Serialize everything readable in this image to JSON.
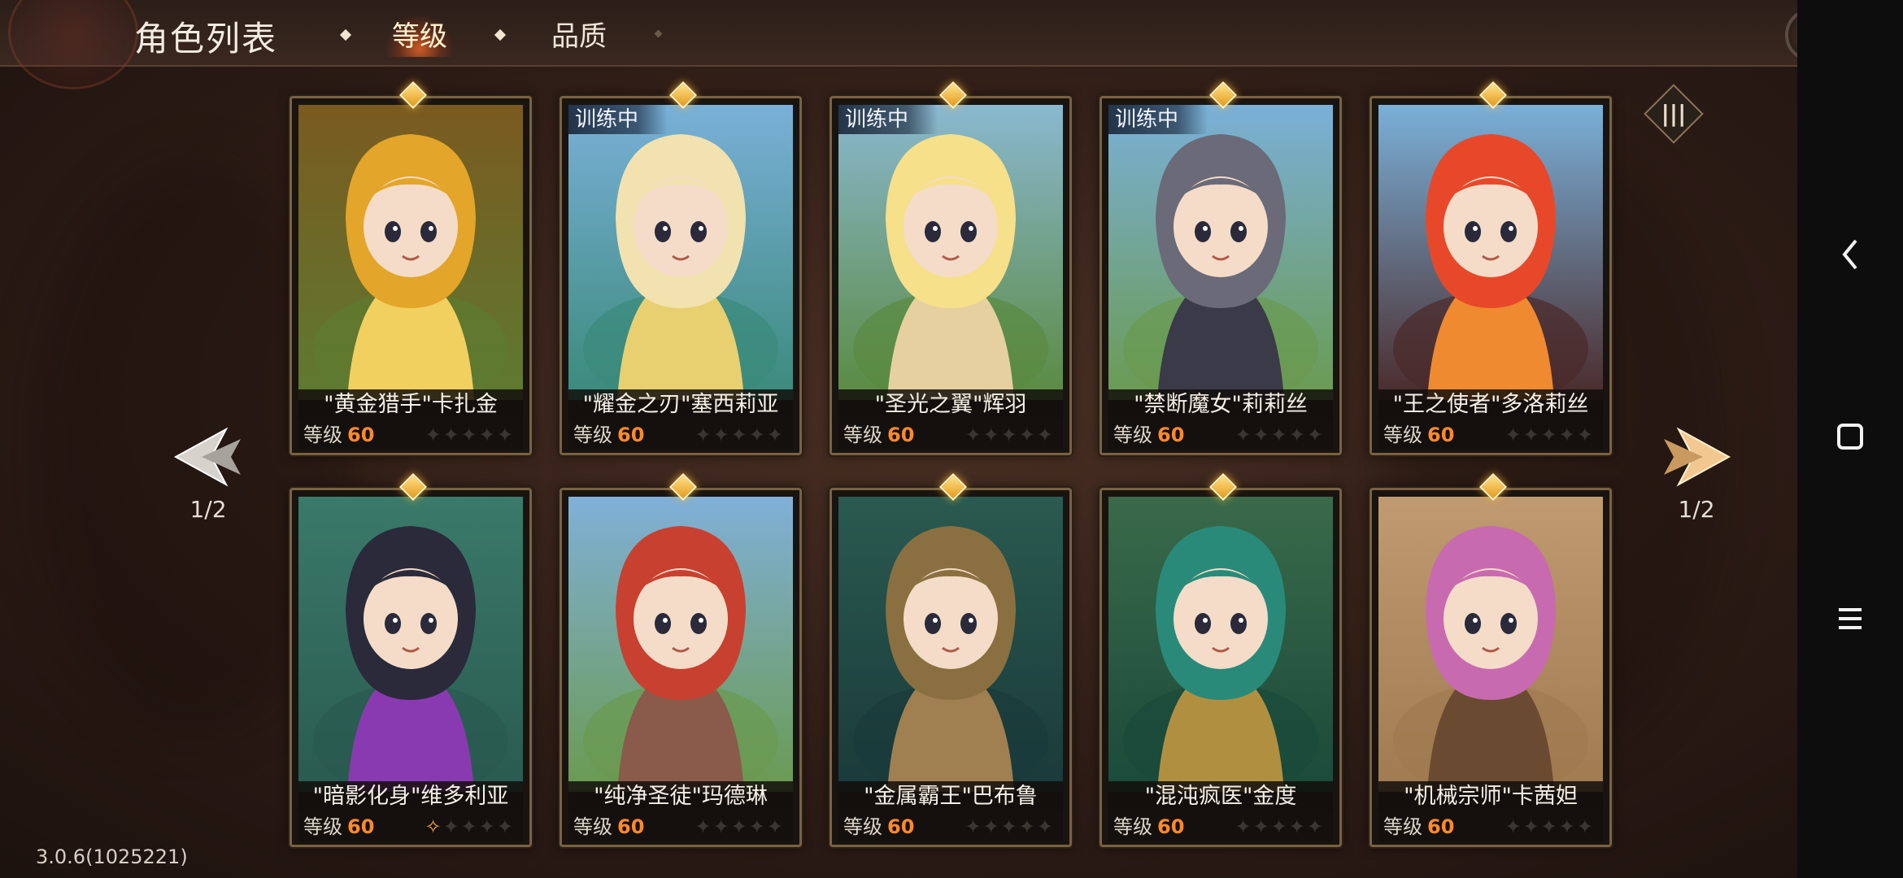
{
  "header": {
    "title": "角色列表",
    "tabs": [
      {
        "label": "等级",
        "active": true
      },
      {
        "label": "品质",
        "active": false
      }
    ]
  },
  "nav": {
    "left_page": "1/2",
    "right_page": "1/2"
  },
  "version": "3.0.6(1025221)",
  "level_label": "等级",
  "training_label": "训练中",
  "characters": [
    {
      "name": "\"黄金猎手\"卡扎金",
      "level": "60",
      "training": false,
      "stars_lit": 0,
      "palette": [
        "#e3a52a",
        "#7a5a20",
        "#f2d060",
        "#5e7a30"
      ]
    },
    {
      "name": "\"耀金之刃\"塞西莉亚",
      "level": "60",
      "training": true,
      "stars_lit": 0,
      "palette": [
        "#f2e2b0",
        "#7ab0d8",
        "#e8d070",
        "#3a8a7a"
      ]
    },
    {
      "name": "\"圣光之翼\"辉羽",
      "level": "60",
      "training": true,
      "stars_lit": 0,
      "palette": [
        "#f6e08a",
        "#8ab8d0",
        "#e6d0a0",
        "#5a8a40"
      ]
    },
    {
      "name": "\"禁断魔女\"莉莉丝",
      "level": "60",
      "training": true,
      "stars_lit": 0,
      "palette": [
        "#6a6a78",
        "#7ab0d8",
        "#3a3a48",
        "#6a9a50"
      ]
    },
    {
      "name": "\"王之使者\"多洛莉丝",
      "level": "60",
      "training": false,
      "stars_lit": 0,
      "palette": [
        "#e8482a",
        "#7ab0d8",
        "#f08a30",
        "#4a2a2a"
      ]
    },
    {
      "name": "\"暗影化身\"维多利亚",
      "level": "60",
      "training": false,
      "stars_lit": 1,
      "palette": [
        "#2a2a3a",
        "#3a7a6a",
        "#8a3ab0",
        "#2a5a50"
      ]
    },
    {
      "name": "\"纯净圣徒\"玛德琳",
      "level": "60",
      "training": false,
      "stars_lit": 0,
      "palette": [
        "#c84030",
        "#80b0d8",
        "#8a5a4a",
        "#6a9a50"
      ]
    },
    {
      "name": "\"金属霸王\"巴布鲁",
      "level": "60",
      "training": false,
      "stars_lit": 0,
      "palette": [
        "#8a7040",
        "#2a5a50",
        "#a08050",
        "#1a3a3a"
      ]
    },
    {
      "name": "\"混沌疯医\"金度",
      "level": "60",
      "training": false,
      "stars_lit": 0,
      "palette": [
        "#2a8a7a",
        "#3a6a4a",
        "#b09040",
        "#1a4a3a"
      ]
    },
    {
      "name": "\"机械宗师\"卡茜妲",
      "level": "60",
      "training": false,
      "stars_lit": 0,
      "palette": [
        "#c86ab0",
        "#c09a70",
        "#6a4a30",
        "#a07a50"
      ]
    }
  ]
}
